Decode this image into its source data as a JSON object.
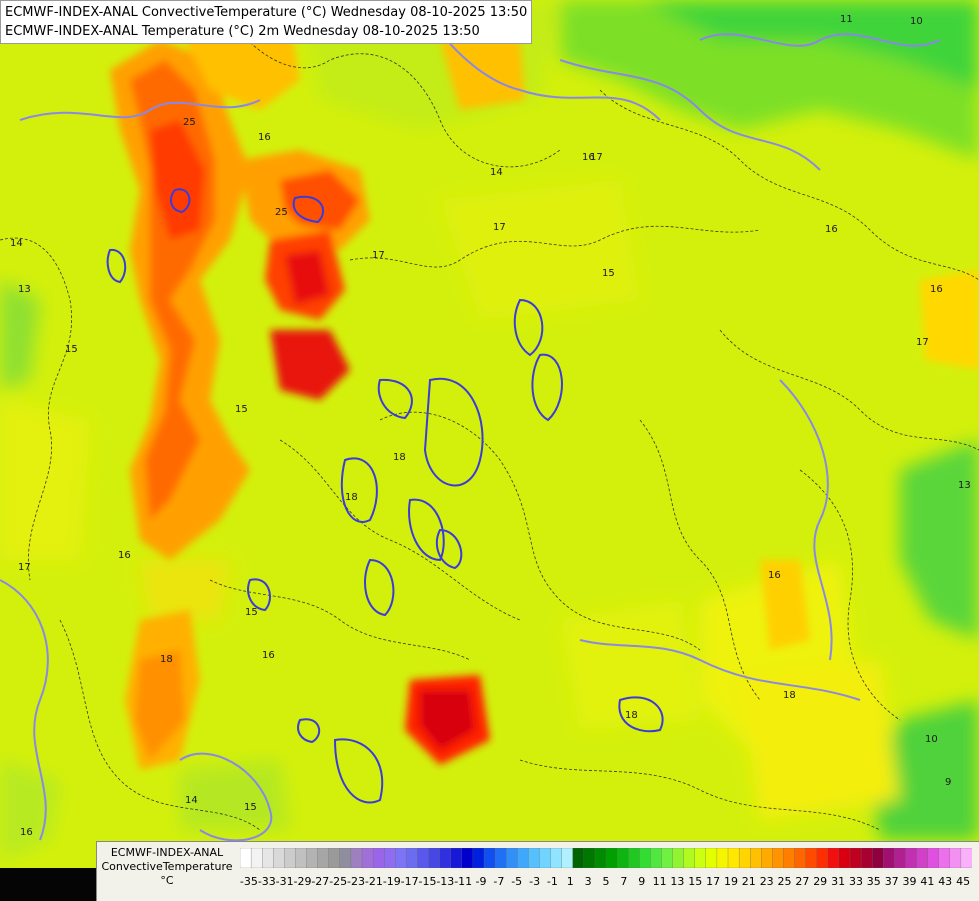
{
  "header": {
    "title_line_1": "ECMWF-INDEX-ANAL ConvectiveTemperature (°C) Wednesday 08-10-2025 13:50",
    "title_line_2": "ECMWF-INDEX-ANAL Temperature (°C) 2m Wednesday 08-10-2025 13:50"
  },
  "legend": {
    "source": "ECMWF-INDEX-ANAL",
    "variable": "ConvectiveTemperature",
    "unit": "°C",
    "tick_labels": [
      "-35",
      "-33",
      "-31",
      "-29",
      "-27",
      "-25",
      "-23",
      "-21",
      "-19",
      "-17",
      "-15",
      "-13",
      "-11",
      "-9",
      "-7",
      "-5",
      "-3",
      "-1",
      "1",
      "3",
      "5",
      "7",
      "9",
      "11",
      "13",
      "15",
      "17",
      "19",
      "21",
      "23",
      "25",
      "27",
      "29",
      "31",
      "33",
      "35",
      "37",
      "39",
      "41",
      "43",
      "45"
    ],
    "colors": [
      "#ffffff",
      "#f3f3f3",
      "#e6e6e6",
      "#d9d9d9",
      "#cccccc",
      "#c0c0c0",
      "#b3b3b3",
      "#a6a6a6",
      "#9a9a9a",
      "#8e8e9e",
      "#9e7fbf",
      "#a070d8",
      "#9b65e8",
      "#8f6cf0",
      "#7d74f5",
      "#6b6cf0",
      "#5a58ec",
      "#4747e6",
      "#3030e0",
      "#1818d8",
      "#0000cc",
      "#0020e0",
      "#1050f0",
      "#2070f5",
      "#3090f8",
      "#40a8fb",
      "#55c0fd",
      "#70d4fe",
      "#90e4ff",
      "#b0f0ff",
      "#006400",
      "#007800",
      "#008c00",
      "#00a000",
      "#10b410",
      "#20c820",
      "#33dc33",
      "#50e840",
      "#70f040",
      "#90f530",
      "#b0fa20",
      "#ccff10",
      "#e4ff00",
      "#f5f500",
      "#ffe800",
      "#ffd400",
      "#ffc000",
      "#ffaa00",
      "#ff9400",
      "#ff7e00",
      "#ff6600",
      "#ff4a00",
      "#ff2e00",
      "#f01010",
      "#d80010",
      "#c00020",
      "#a80030",
      "#900040",
      "#a01070",
      "#b02090",
      "#c030b0",
      "#d040c8",
      "#e050e0",
      "#ec70ec",
      "#f490f4",
      "#fab0fa"
    ]
  },
  "map": {
    "contour_labels": [
      "25",
      "25",
      "16",
      "14",
      "17",
      "16",
      "15",
      "17",
      "18",
      "18",
      "18",
      "18",
      "16",
      "15",
      "14",
      "13",
      "10",
      "11",
      "15",
      "14",
      "15",
      "16",
      "17",
      "18",
      "17",
      "16",
      "16",
      "13",
      "15",
      "16",
      "17",
      "10",
      "9",
      "16"
    ],
    "background_color": "#d6f20a"
  }
}
